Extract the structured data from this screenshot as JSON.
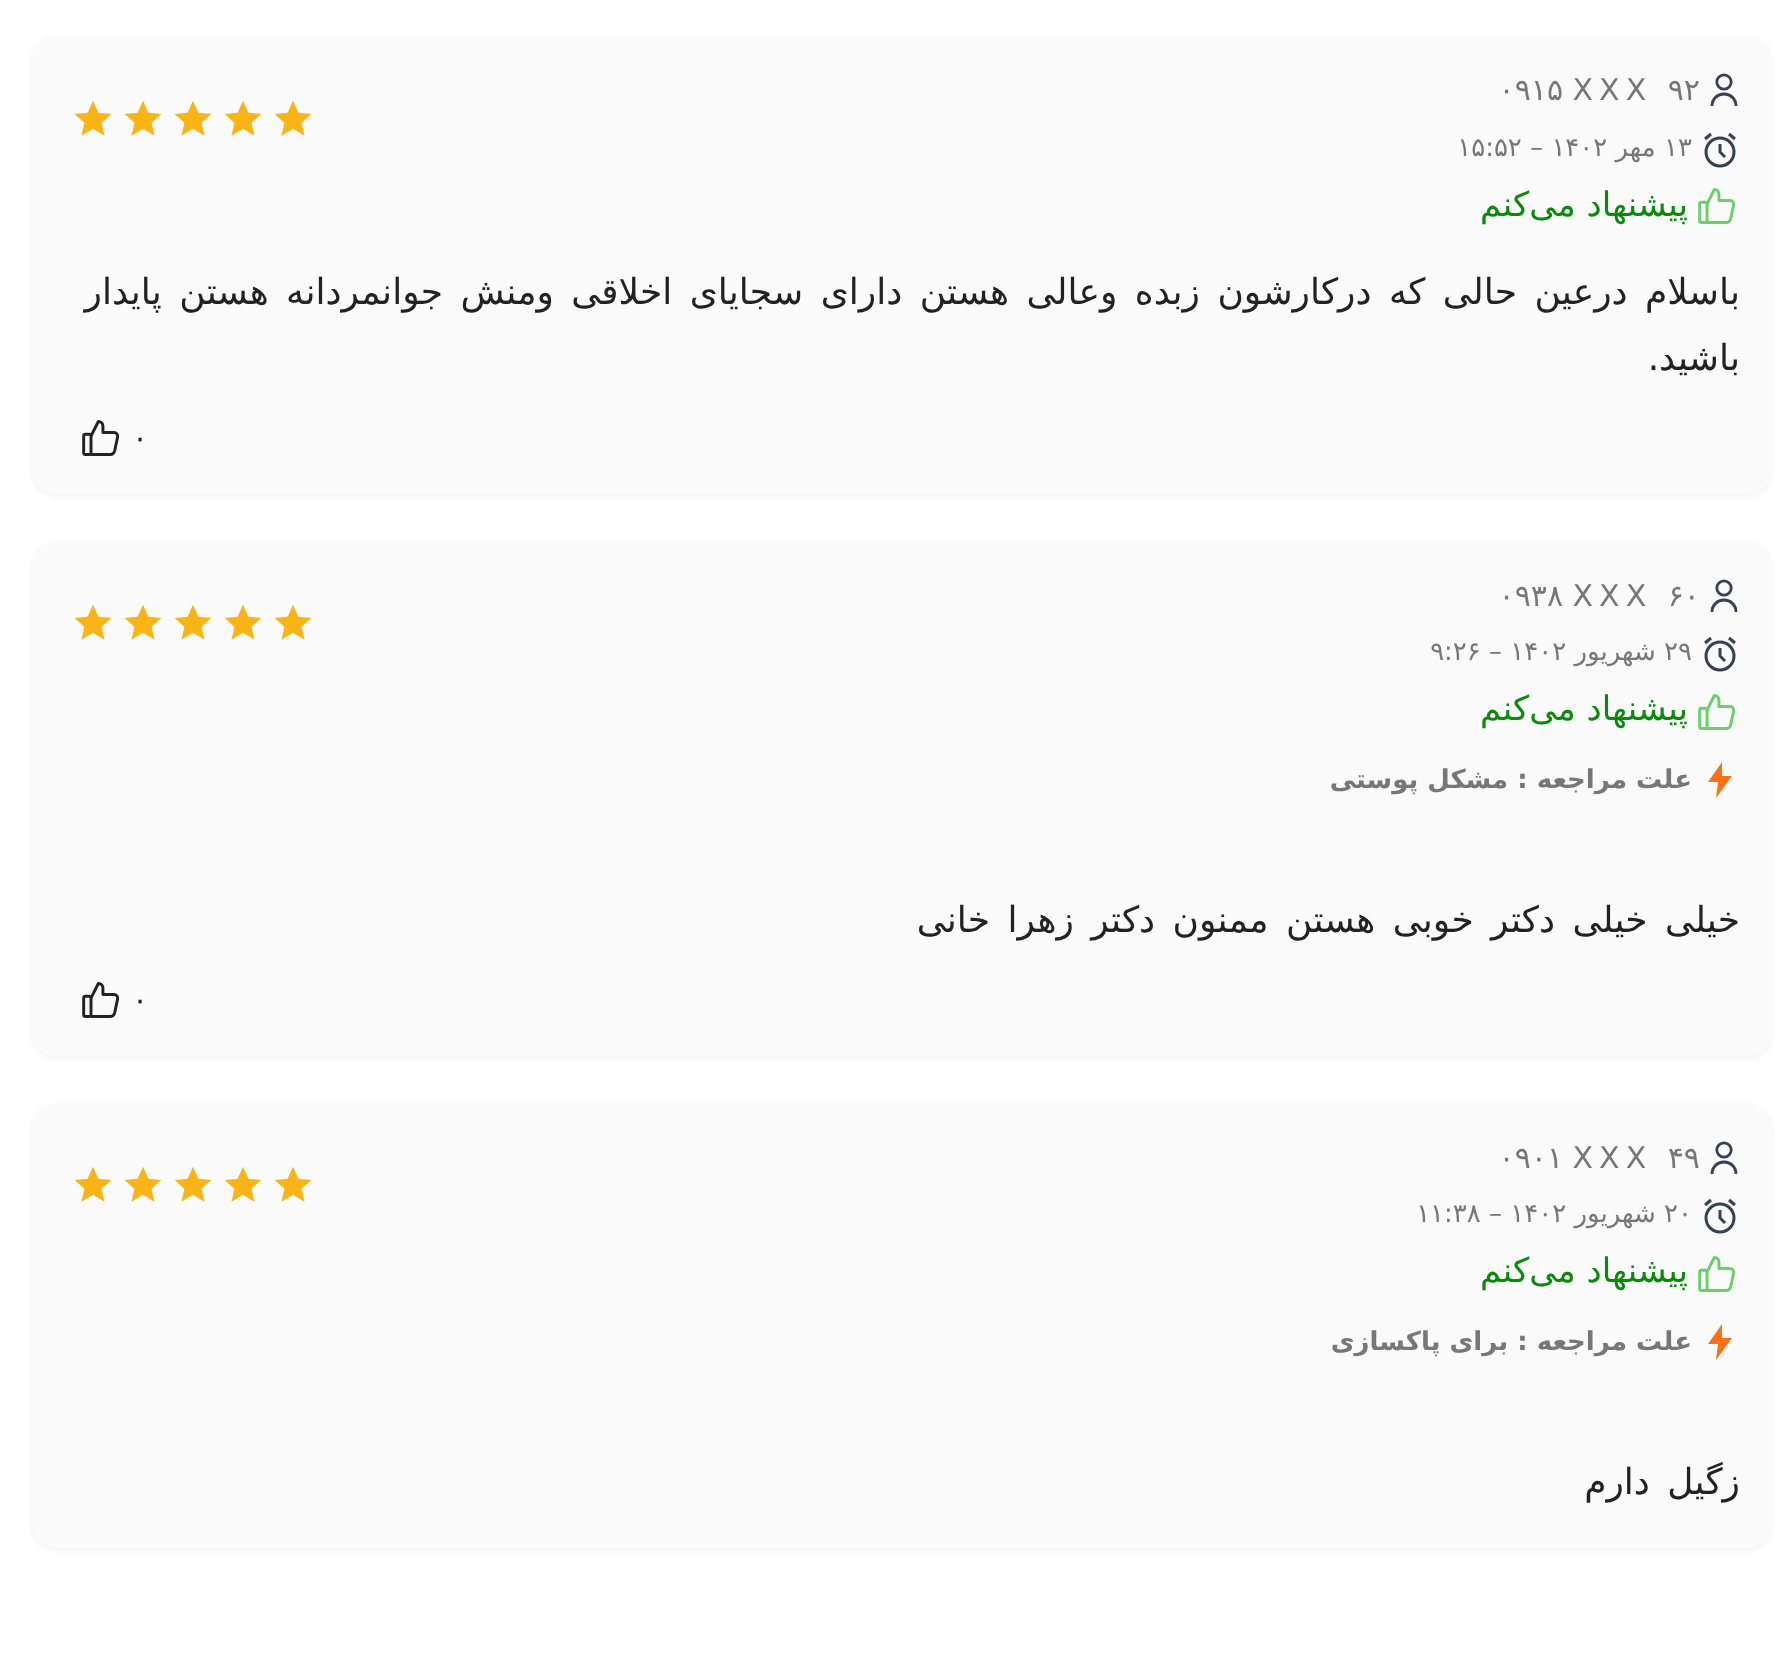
{
  "reviews": [
    {
      "phone": "۰۹۱۵ XXX ۹۲",
      "date": "۱۳ مهر ۱۴۰۲ – ۱۵:۵۲",
      "stars": 5,
      "recommend": "پیشنهاد می‌کنم",
      "text": "باسلام درعین حالی که درکارشون زبده وعالی هستن دارای سجایای اخلاقی ومنش جوانمردانه هستن پایدار باشید.",
      "likes": "۰"
    },
    {
      "phone": "۰۹۳۸ XXX ۶۰",
      "date": "۲۹ شهریور ۱۴۰۲ – ۹:۲۶",
      "stars": 5,
      "recommend": "پیشنهاد می‌کنم",
      "reason": "علت مراجعه : مشکل پوستی",
      "text": "خیلی خیلی دکتر خوبی هستن ممنون دکتر زهرا خانی",
      "likes": "۰"
    },
    {
      "phone": "۰۹۰۱ XXX ۴۹",
      "date": "۲۰ شهریور ۱۴۰۲ – ۱۱:۳۸",
      "stars": 5,
      "recommend": "پیشنهاد می‌کنم",
      "reason": "علت مراجعه : برای پاکسازی",
      "text": "زگیل دارم"
    }
  ]
}
